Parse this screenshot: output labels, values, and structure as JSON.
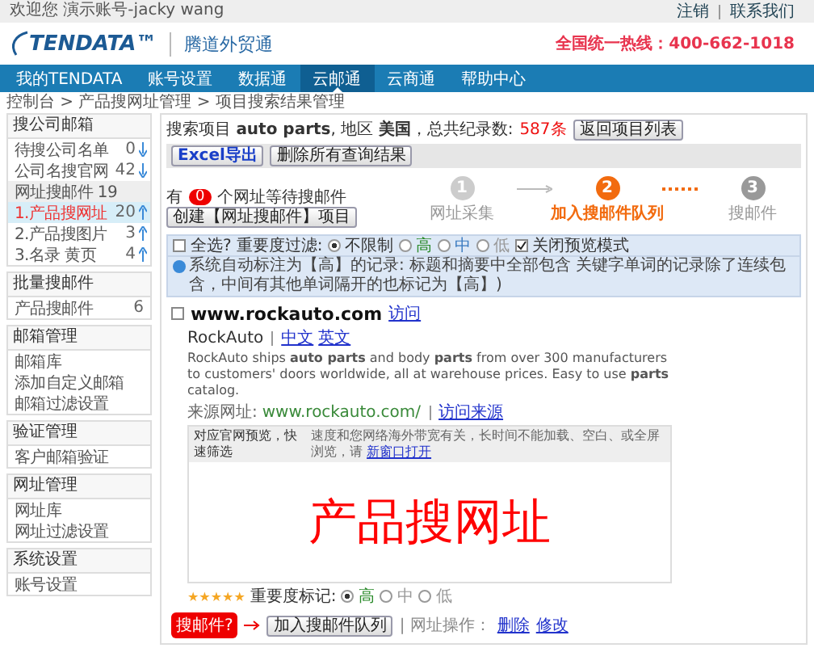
{
  "top_bar": {
    "welcome": "欢迎您 演示账号-jacky wang",
    "links": [
      "注销",
      "联系我们"
    ]
  },
  "header": {
    "logo": "TENDATA™",
    "product": "腾道外贸通",
    "hotline": "全国统一热线：400-662-1018"
  },
  "nav": [
    {
      "label": "我的TENDATA",
      "selected": false
    },
    {
      "label": "账号设置",
      "selected": false
    },
    {
      "label": "数据通",
      "selected": false
    },
    {
      "label": "云邮通",
      "selected": true
    },
    {
      "label": "云商通",
      "selected": false
    },
    {
      "label": "帮助中心",
      "selected": false
    }
  ],
  "breadcrumb": "控制台 > 产品搜网址管理 > 项目搜索结果管理",
  "sidebar": [
    {
      "title": "搜公司邮箱",
      "items": [
        {
          "kind": "item",
          "label": "待搜公司名单",
          "count": "0",
          "arrow_up": false,
          "selected": false
        },
        {
          "kind": "item",
          "label": "公司名搜官网",
          "count": "42",
          "arrow_up": false,
          "selected": false
        },
        {
          "kind": "subheader",
          "label": "网址搜邮件 19",
          "selected": false
        },
        {
          "kind": "item",
          "label": "1.产品搜网址",
          "count": "20",
          "arrow_up": true,
          "selected": true
        },
        {
          "kind": "item",
          "label": "2.产品搜图片",
          "count": "3",
          "arrow_up": true,
          "selected": false
        },
        {
          "kind": "item",
          "label": "3.名录 黄页",
          "count": "4",
          "arrow_up": true,
          "selected": false
        }
      ]
    },
    {
      "title": "批量搜邮件",
      "items": [
        {
          "kind": "item",
          "label": "产品搜邮件",
          "count": "6",
          "selected": false
        }
      ]
    },
    {
      "title": "邮箱管理",
      "items": [
        {
          "kind": "item",
          "label": "邮箱库",
          "selected": false
        },
        {
          "kind": "item",
          "label": "添加自定义邮箱",
          "selected": false
        },
        {
          "kind": "item",
          "label": "邮箱过滤设置",
          "selected": false
        }
      ]
    },
    {
      "title": "验证管理",
      "items": [
        {
          "kind": "item",
          "label": "客户邮箱验证",
          "selected": false
        }
      ]
    },
    {
      "title": "网址管理",
      "items": [
        {
          "kind": "item",
          "label": "网址库",
          "selected": false
        },
        {
          "kind": "item",
          "label": "网址过滤设置",
          "selected": false
        }
      ]
    },
    {
      "title": "系统设置",
      "items": [
        {
          "kind": "item",
          "label": "账号设置",
          "selected": false
        }
      ]
    }
  ],
  "summary": {
    "text": "搜索项目 **auto parts**, 地区 **美国**，总共纪录数:",
    "count": "587条",
    "button": "返回项目列表"
  },
  "actions": [
    "Excel导出",
    "删除所有查询结果"
  ],
  "waiting": {
    "prefix": "有",
    "count": "0",
    "suffix": "个网址等待搜邮件",
    "button": "创建【网址搜邮件】项目"
  },
  "steps": [
    {
      "number": "1",
      "label": "网址采集",
      "selected": false
    },
    {
      "number": "2",
      "label": "加入搜邮件队列",
      "selected": true
    },
    {
      "number": "3",
      "label": "搜邮件",
      "selected": false
    }
  ],
  "filter": {
    "select_all": {
      "label": "全选?",
      "checked": false
    },
    "label": "重要度过滤:",
    "options": [
      {
        "label": "不限制",
        "selected": true
      },
      {
        "label": "高",
        "selected": false
      },
      {
        "label": "中",
        "selected": false
      },
      {
        "label": "低",
        "selected": false
      }
    ],
    "preview_off": {
      "label": "关闭预览模式",
      "checked": true
    }
  },
  "notice": "系统自动标注为【高】的记录: 标题和摘要中全部包含 关键字单词的记录除了连续包含，中间有其他单词隔开的也标记为【高】)",
  "result": {
    "checked": false,
    "url": "www.rockauto.com",
    "visit": "访问",
    "site": "RockAuto",
    "langs": [
      "中文",
      "英文"
    ],
    "description": "RockAuto ships **auto parts** and body **parts** from over 300 manufacturers to customers' doors worldwide, all at warehouse prices. Easy to use **parts** catalog.",
    "source_label": "来源网址:",
    "source_url": "www.rockauto.com/",
    "source_link": "访问来源",
    "preview": {
      "title": "对应官网预览，快速筛选",
      "hint": "速度和您网络海外带宽有关，长时间不能加载、空白、或全屏浏览，请",
      "link": "新窗口打开",
      "overlay": "产品搜网址"
    },
    "stars": 5,
    "importance_label": "重要度标记:",
    "importance": [
      {
        "label": "高",
        "selected": true
      },
      {
        "label": "中",
        "selected": false
      },
      {
        "label": "低",
        "selected": false
      }
    ],
    "search_button": "搜邮件?",
    "queue_button": "加入搜邮件队列",
    "ops_label": "| 网址操作：",
    "ops": [
      "删除",
      "修改"
    ]
  }
}
